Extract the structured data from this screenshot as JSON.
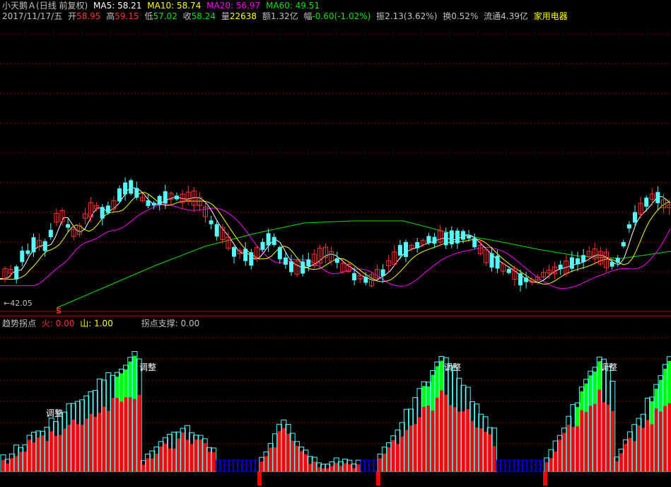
{
  "header": {
    "stock_name": "小天鹅Ａ",
    "period": "(日线 前复权)",
    "ma5_label": "MA5: 58.21",
    "ma10_label": "MA10: 58.74",
    "ma20_label": "MA20: 56.97",
    "ma60_label": "MA60: 49.51"
  },
  "quote": {
    "date": "2017/11/17/五",
    "open_label": "开",
    "open": "58.95",
    "high_label": "高",
    "high": "59.15",
    "low_label": "低",
    "low": "57.02",
    "close_label": "收",
    "close": "58.24",
    "volume_label": "量",
    "volume": "22638",
    "amount": "额1.32亿",
    "change_label": "幅",
    "change": "-0.60(-1.02%)",
    "amplitude": "振2.13(3.62%)",
    "turnover": "换0.52%",
    "float_cap": "流通4.39亿",
    "industry": "家用电器"
  },
  "main_chart": {
    "low_marker": "←42.05",
    "signal_marker": "S"
  },
  "indicator": {
    "name": "趋势拐点",
    "fire_label": "火: 0.00",
    "mountain_label": "山: 1.00",
    "support_label": "拐点支撑: 0.00",
    "annotation": "调整"
  },
  "colors": {
    "up": "#ff3232",
    "down": "#54fcfc",
    "ma5": "#ffffff",
    "ma10": "#ffff00",
    "ma20": "#ff00ff",
    "ma60": "#00e600",
    "grid": "#8b0000",
    "hist_red": "#ff0000",
    "hist_green": "#00ff00",
    "hist_outline": "#54fcfc",
    "hist_blue": "#0000ff"
  }
}
